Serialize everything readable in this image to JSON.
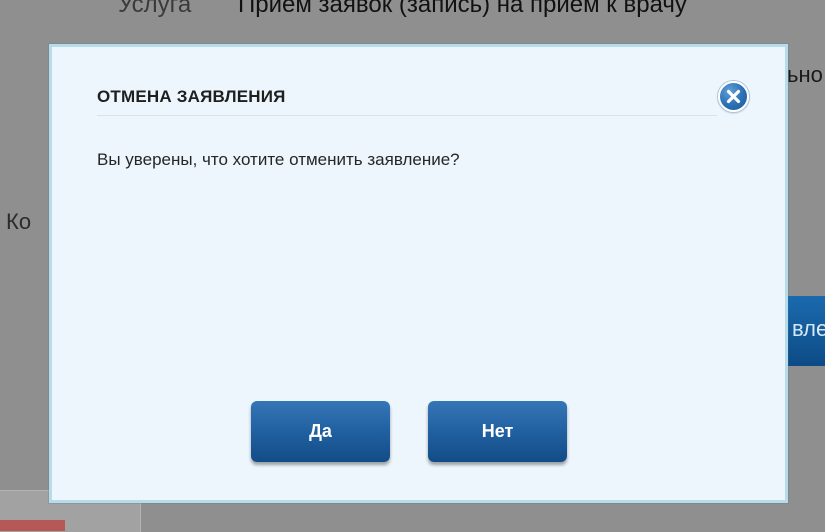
{
  "background": {
    "service_label": "Услуга",
    "service_value": "Прием заявок (запись) на прием к врачу",
    "right_fragment": "ьно",
    "left_fragment": "Ко",
    "right_button_fragment": "вле"
  },
  "dialog": {
    "title": "ОТМЕНА ЗАЯВЛЕНИЯ",
    "message": "Вы уверены, что хотите отменить заявление?",
    "close_icon": "close-icon",
    "yes_label": "Да",
    "no_label": "Нет"
  },
  "colors": {
    "dialog_background": "#ecf6fc",
    "dialog_border": "#b7dbe8",
    "button_blue": "#1f5e9e",
    "overlay": "#8f8f8f"
  }
}
